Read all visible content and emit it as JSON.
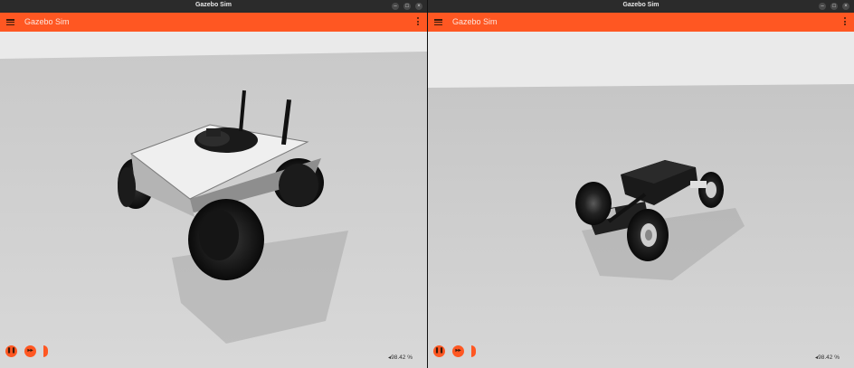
{
  "windows": [
    {
      "title": "Gazebo Sim",
      "app_title": "Gazebo Sim",
      "rtf": "98.42 %",
      "controls": {
        "play_icon": "pause-icon",
        "step_icon": "step-icon"
      },
      "window_controls": [
        "minimize-icon",
        "maximize-icon",
        "close-icon"
      ]
    },
    {
      "title": "Gazebo Sim",
      "app_title": "Gazebo Sim",
      "rtf": "98.42 %",
      "controls": {
        "play_icon": "pause-icon",
        "step_icon": "step-icon"
      },
      "window_controls": [
        "minimize-icon",
        "maximize-icon",
        "close-icon"
      ]
    }
  ],
  "colors": {
    "accent": "#ff5722",
    "titlebar": "#2b2b2b",
    "ground": "#cfcfcf",
    "sky": "#e9e9e9"
  }
}
